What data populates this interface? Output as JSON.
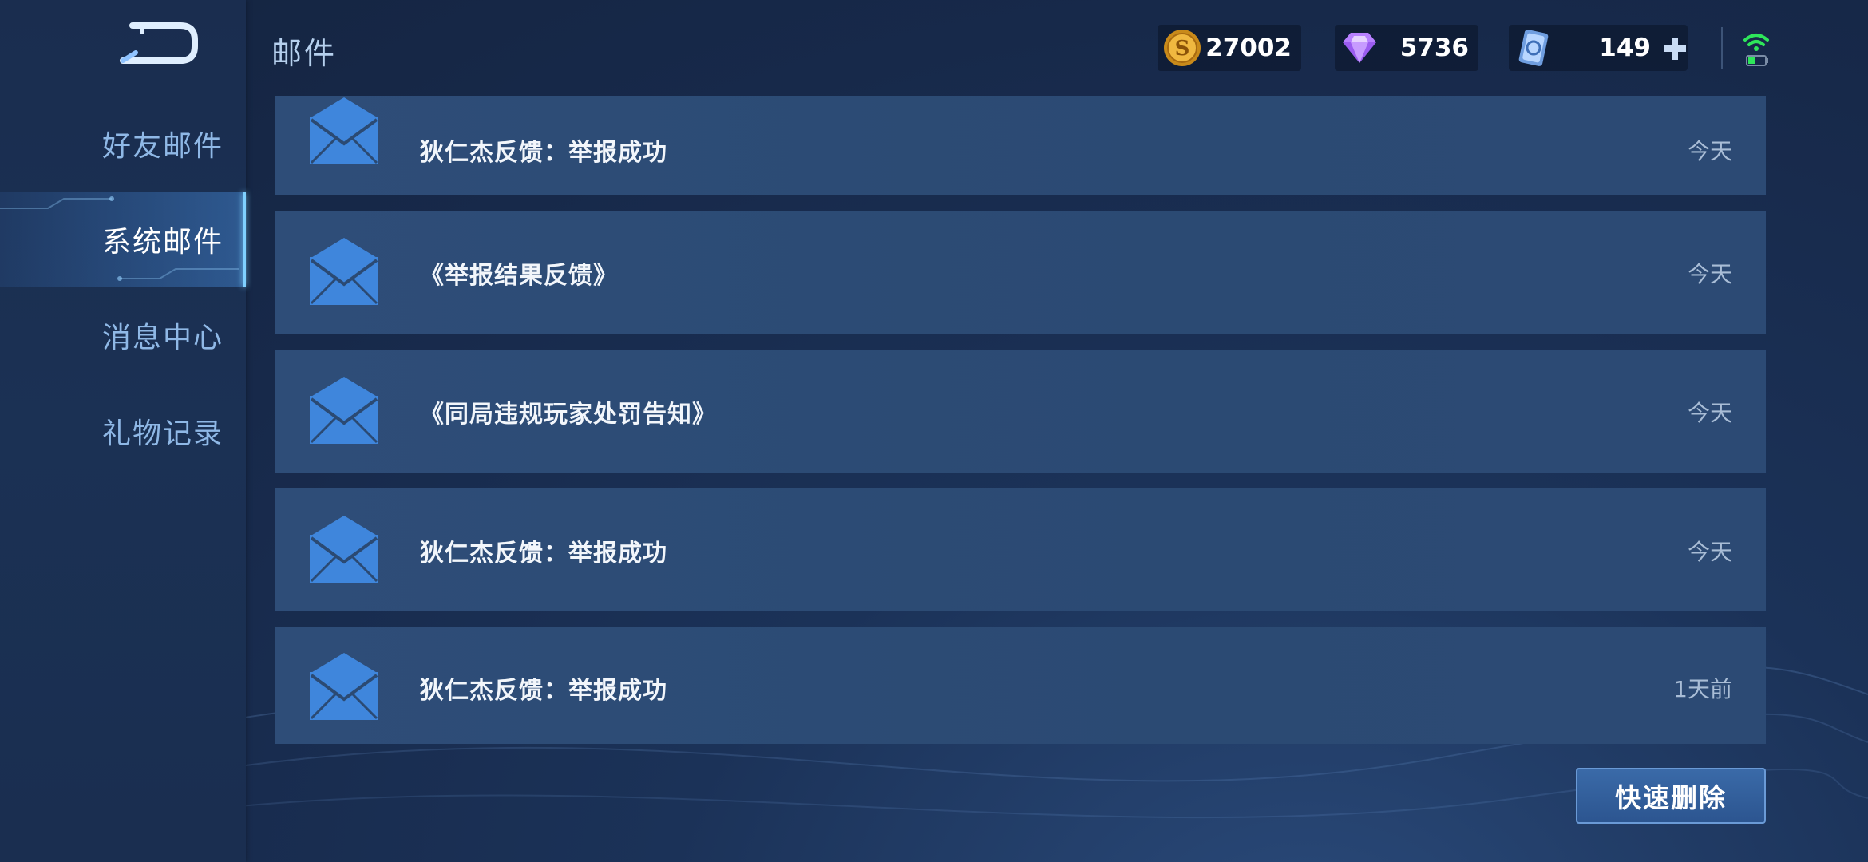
{
  "header": {
    "title": "邮件",
    "back_icon": "back-arrow-icon",
    "currencies": [
      {
        "name": "gold-coin",
        "icon": "gold-coin-icon",
        "value": "27002"
      },
      {
        "name": "diamond",
        "icon": "diamond-icon",
        "value": "5736"
      },
      {
        "name": "coupon",
        "icon": "coupon-card-icon",
        "value": "149"
      }
    ],
    "add_icon": "plus-icon",
    "signal_icon": "wifi-battery-icon"
  },
  "sidebar": {
    "items": [
      {
        "label": "好友邮件",
        "active": false
      },
      {
        "label": "系统邮件",
        "active": true
      },
      {
        "label": "消息中心",
        "active": false
      },
      {
        "label": "礼物记录",
        "active": false
      }
    ]
  },
  "mails": [
    {
      "title": "狄仁杰反馈：举报成功",
      "time": "今天",
      "icon": "envelope-icon"
    },
    {
      "title": "《举报结果反馈》",
      "time": "今天",
      "icon": "envelope-icon"
    },
    {
      "title": "《同局违规玩家处罚告知》",
      "time": "今天",
      "icon": "envelope-icon"
    },
    {
      "title": "狄仁杰反馈：举报成功",
      "time": "今天",
      "icon": "envelope-icon"
    },
    {
      "title": "狄仁杰反馈：举报成功",
      "time": "1天前",
      "icon": "envelope-icon"
    }
  ],
  "actions": {
    "quick_delete_label": "快速删除"
  },
  "colors": {
    "background": "#17294a",
    "row": "#2d4b76",
    "accent": "#7fd0ff",
    "envelope": "#3f86dc",
    "signal": "#2ee65a"
  }
}
